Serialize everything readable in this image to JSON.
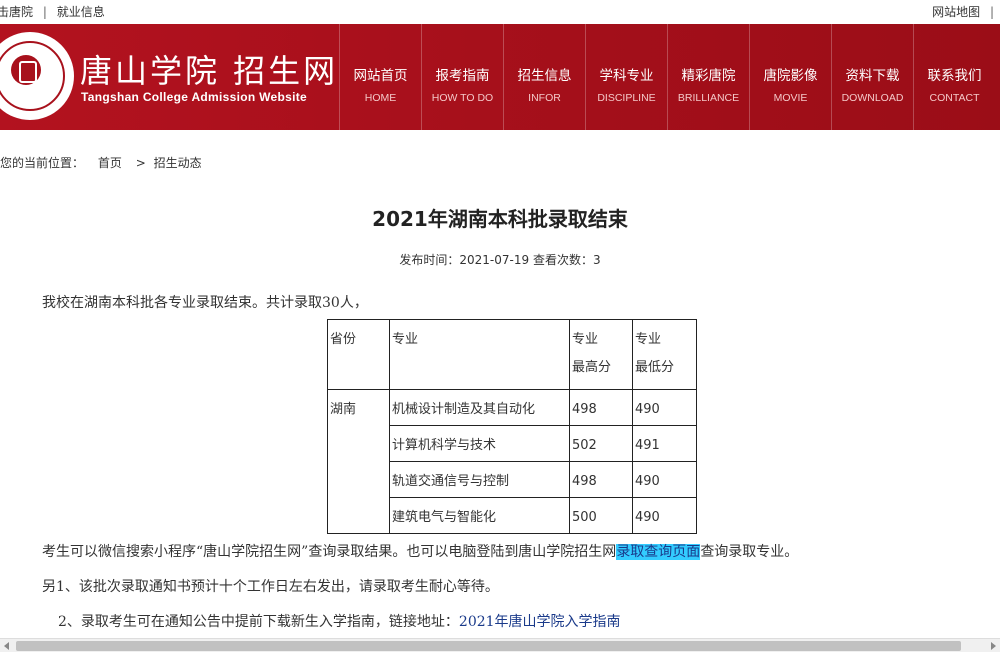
{
  "topbar": {
    "left_links": [
      "击唐院",
      "就业信息"
    ],
    "separator": "|",
    "right_links": [
      "网站地图",
      "|"
    ]
  },
  "header": {
    "title": "唐山学院 招生网",
    "subtitle": "Tangshan College Admission Website",
    "brand_color": "#a8111c",
    "nav": [
      {
        "cn": "网站首页",
        "en": "HOME"
      },
      {
        "cn": "报考指南",
        "en": "HOW TO DO"
      },
      {
        "cn": "招生信息",
        "en": "INFOR"
      },
      {
        "cn": "学科专业",
        "en": "DISCIPLINE"
      },
      {
        "cn": "精彩唐院",
        "en": "BRILLIANCE"
      },
      {
        "cn": "唐院影像",
        "en": "MOVIE"
      },
      {
        "cn": "资料下载",
        "en": "DOWNLOAD"
      },
      {
        "cn": "联系我们",
        "en": "CONTACT"
      }
    ]
  },
  "breadcrumb": {
    "label": "您的当前位置：",
    "home": "首页",
    "arrow": ">",
    "current": "招生动态"
  },
  "article": {
    "title": "2021年湖南本科批录取结束",
    "meta": "发布时间：2021-07-19  查看次数：3",
    "intro": "我校在湖南本科批各专业录取结束。共计录取30人，",
    "table": {
      "headers": [
        "省份",
        "专业",
        "专业\n最高分",
        "专业\n最低分"
      ],
      "header_h1": [
        "专业",
        "最高分"
      ],
      "header_h2": [
        "专业",
        "最低分"
      ],
      "province": "湖南",
      "rows": [
        {
          "major": "机械设计制造及其自动化",
          "max": "498",
          "min": "490"
        },
        {
          "major": "计算机科学与技术",
          "max": "502",
          "min": "491"
        },
        {
          "major": "轨道交通信号与控制",
          "max": "498",
          "min": "490"
        },
        {
          "major": "建筑电气与智能化",
          "max": "500",
          "min": "490"
        }
      ]
    },
    "p2_before": "考生可以微信搜索小程序“唐山学院招生网”查询录取结果。也可以电脑登陆到唐山学院招生网",
    "p2_link": "录取查询页面",
    "p2_after": "查询录取专业。",
    "p3": "另1、该批次录取通知书预计十个工作日左右发出，请录取考生耐心等待。",
    "p4_before": "2、录取考生可在通知公告中提前下载新生入学指南，链接地址：",
    "p4_link": "2021年唐山学院入学指南",
    "highlight_color": "#33ccff",
    "link_color": "#1a3a8a"
  }
}
